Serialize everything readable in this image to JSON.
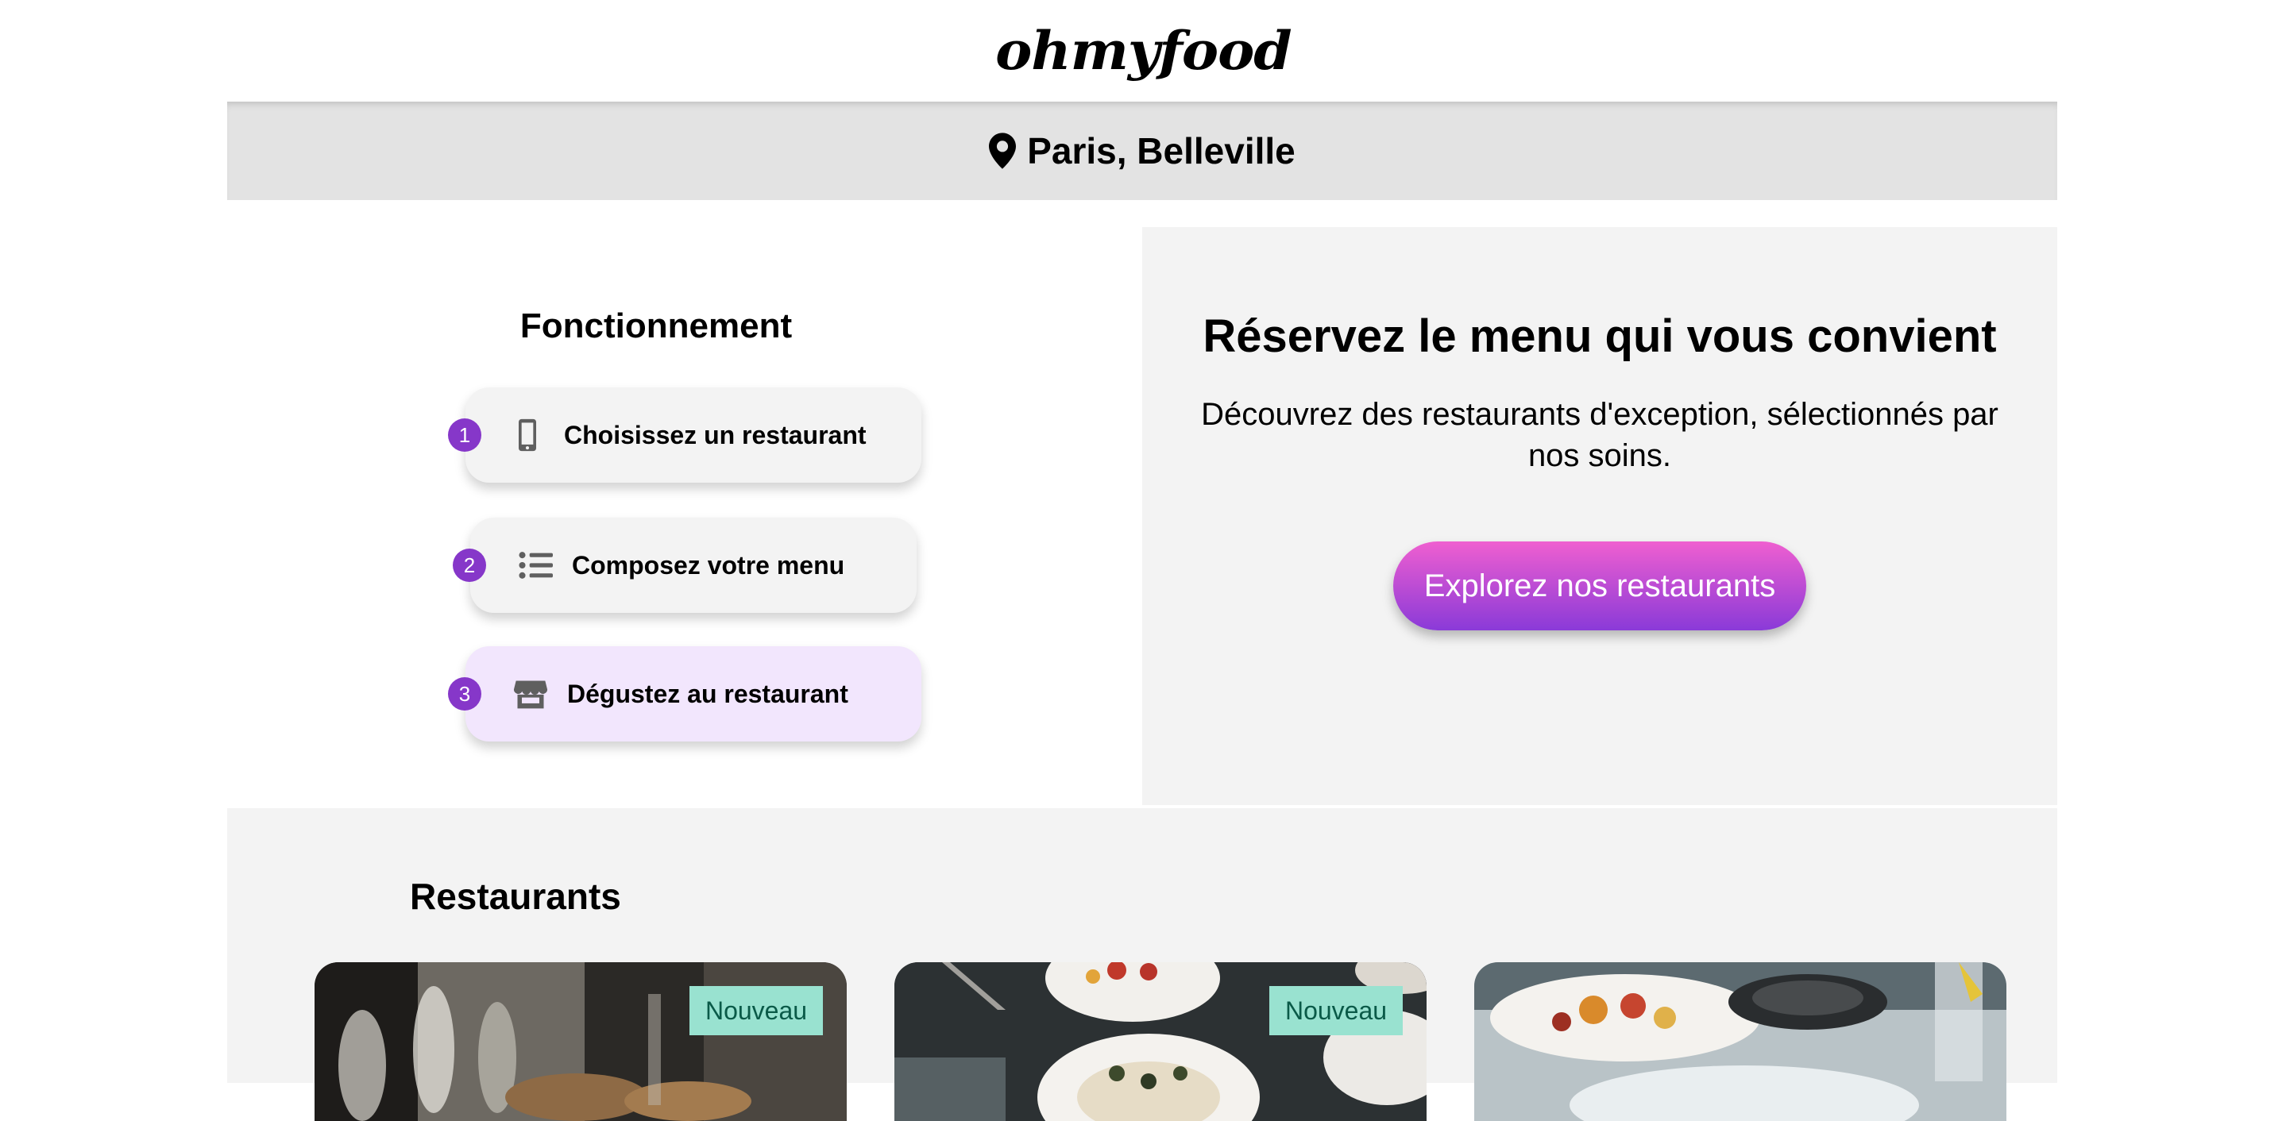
{
  "header": {
    "logo": "ohmyfood"
  },
  "location": {
    "text": "Paris, Belleville",
    "icon": "map-pin-icon"
  },
  "how_it_works": {
    "title": "Fonctionnement",
    "steps": [
      {
        "number": "1",
        "label": "Choisissez un restaurant",
        "icon": "mobile-phone-icon",
        "active": false
      },
      {
        "number": "2",
        "label": "Composez votre menu",
        "icon": "list-icon",
        "active": false
      },
      {
        "number": "3",
        "label": "Dégustez au restaurant",
        "icon": "store-icon",
        "active": true
      }
    ]
  },
  "promo": {
    "title": "Réservez le menu qui vous convient",
    "text": "Découvrez des restaurants d'exception, sélectionnés par nos soins.",
    "button_label": "Explorez nos restaurants"
  },
  "restaurants": {
    "title": "Restaurants",
    "cards": [
      {
        "badge": "Nouveau"
      },
      {
        "badge": "Nouveau"
      },
      {
        "badge": ""
      }
    ]
  },
  "colors": {
    "accent_purple": "#8637c9",
    "button_gradient_top": "#ef5fd0",
    "button_gradient_bottom": "#8a3ad8",
    "badge_bg": "#99e2d0",
    "active_step_bg": "#f2e6fd"
  }
}
